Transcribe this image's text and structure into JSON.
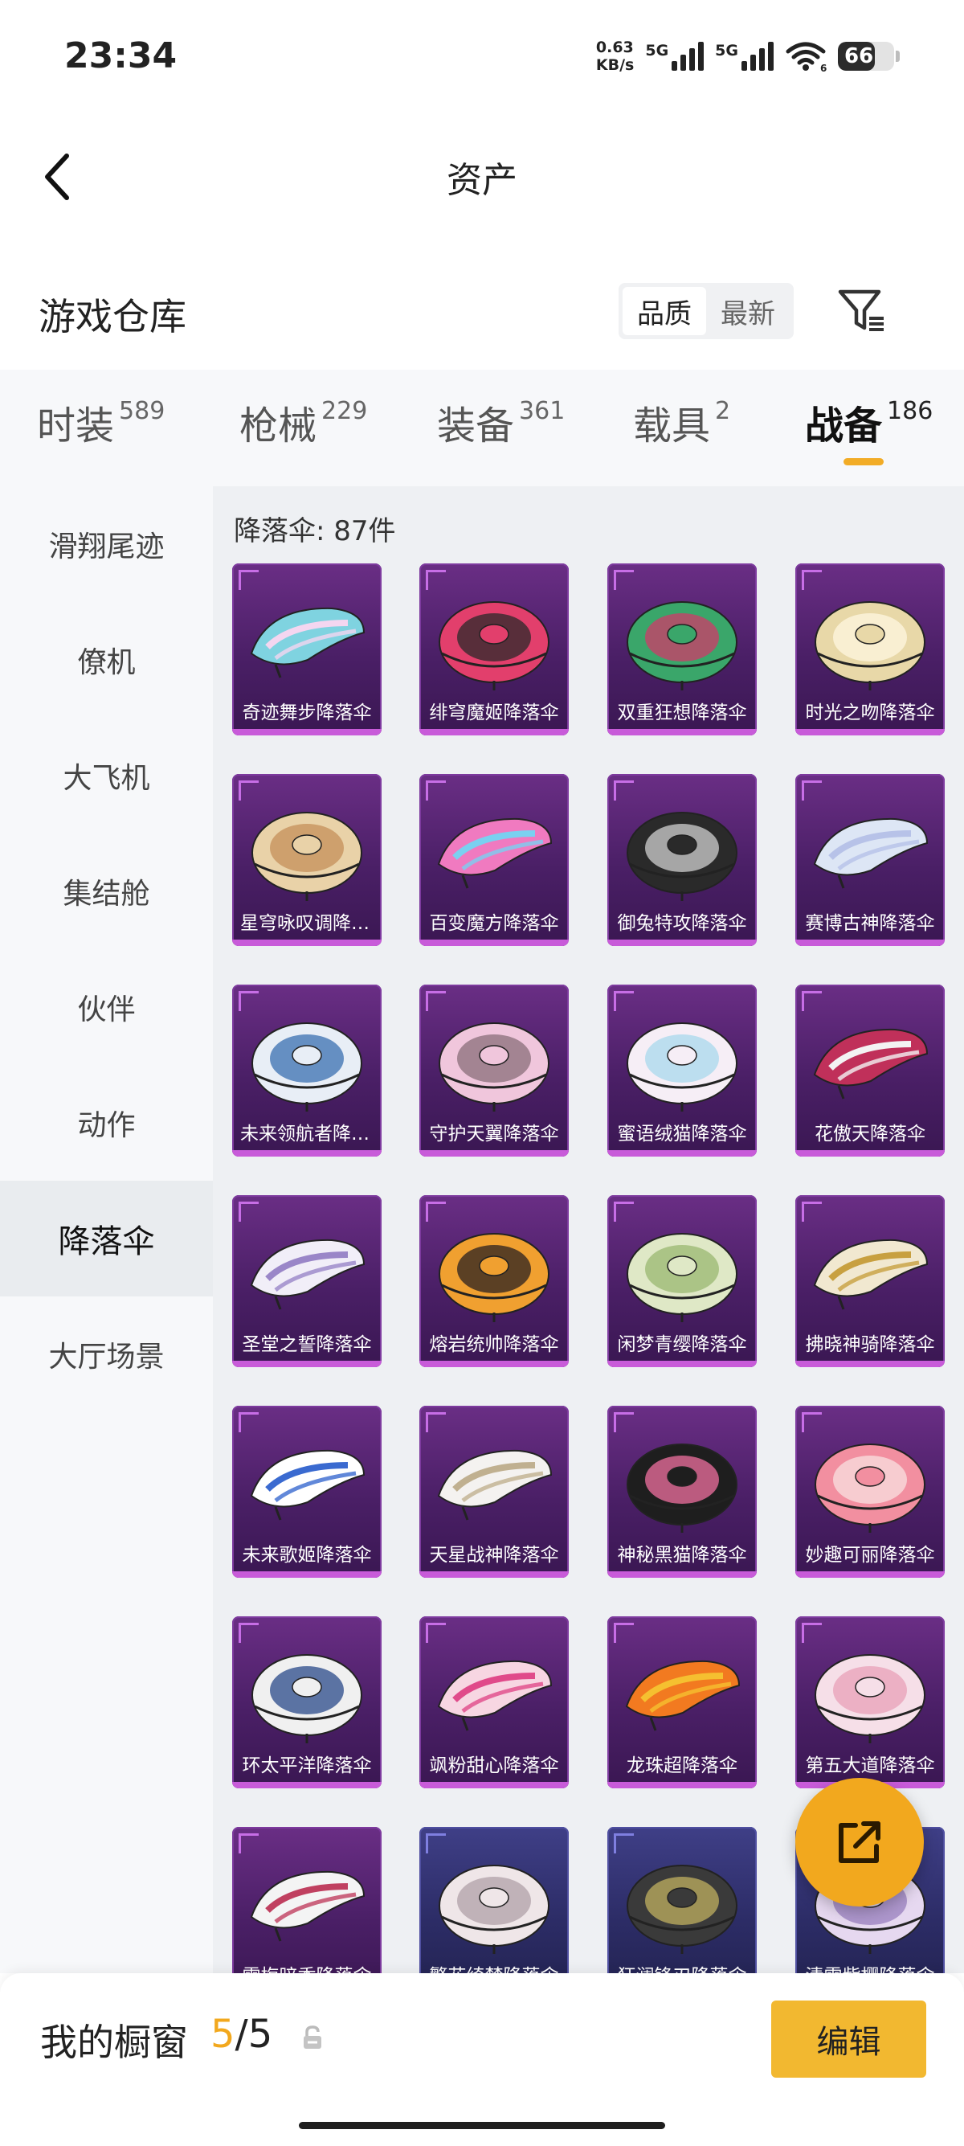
{
  "status_bar": {
    "time": "23:34",
    "net_speed_value": "0.63",
    "net_speed_unit": "KB/s",
    "sim1_label": "5G",
    "sim2_label": "5G",
    "wifi_badge": "6",
    "battery": "66",
    "battery_level": 0.66
  },
  "header": {
    "title": "资产"
  },
  "section": {
    "title": "游戏仓库",
    "sort_options": [
      "品质",
      "最新"
    ],
    "sort_active": "品质"
  },
  "category_tabs": [
    {
      "label": "时装",
      "count": "589"
    },
    {
      "label": "枪械",
      "count": "229"
    },
    {
      "label": "装备",
      "count": "361"
    },
    {
      "label": "载具",
      "count": "2"
    },
    {
      "label": "战备",
      "count": "186"
    }
  ],
  "active_tab": "战备",
  "sidebar": {
    "items": [
      "滑翔尾迹",
      "僚机",
      "大飞机",
      "集结舱",
      "伙伴",
      "动作",
      "降落伞",
      "大厅场景"
    ],
    "active": "降落伞"
  },
  "grid": {
    "header": "降落伞: 87件",
    "items": [
      {
        "name": "奇迹舞步降落伞",
        "c1": "#7fd3e0",
        "c2": "#f4d6f0",
        "tier": "purple",
        "shape": "canopy"
      },
      {
        "name": "绯穹魔姬降落伞",
        "c1": "#e23f6c",
        "c2": "#2a2a2a",
        "tier": "purple",
        "shape": "dome"
      },
      {
        "name": "双重狂想降落伞",
        "c1": "#3aa66a",
        "c2": "#d03a6a",
        "tier": "purple",
        "shape": "dome"
      },
      {
        "name": "时光之吻降落伞",
        "c1": "#e8d8a8",
        "c2": "#fff7e0",
        "tier": "purple",
        "shape": "dome"
      },
      {
        "name": "星穹咏叹调降落伞",
        "c1": "#e9d2a8",
        "c2": "#c48f5a",
        "tier": "purple",
        "shape": "dome"
      },
      {
        "name": "百变魔方降落伞",
        "c1": "#f07ac0",
        "c2": "#7ad0f0",
        "tier": "purple",
        "shape": "canopy"
      },
      {
        "name": "御兔特攻降落伞",
        "c1": "#2a2a2a",
        "c2": "#d0d0d0",
        "tier": "purple",
        "shape": "dome"
      },
      {
        "name": "赛博古神降落伞",
        "c1": "#dde6f5",
        "c2": "#b7c2e8",
        "tier": "purple",
        "shape": "canopy"
      },
      {
        "name": "未来领航者降落伞",
        "c1": "#e8eef6",
        "c2": "#3a6fb0",
        "tier": "purple",
        "shape": "dome"
      },
      {
        "name": "守护天翼降落伞",
        "c1": "#f0c6dc",
        "c2": "#8a6e7a",
        "tier": "purple",
        "shape": "dome"
      },
      {
        "name": "蜜语绒猫降落伞",
        "c1": "#f6eef6",
        "c2": "#a8d8ec",
        "tier": "purple",
        "shape": "dome"
      },
      {
        "name": "花傲天降落伞",
        "c1": "#c0305a",
        "c2": "#f3f3f3",
        "tier": "purple",
        "shape": "canopy"
      },
      {
        "name": "圣堂之誓降落伞",
        "c1": "#f1eef8",
        "c2": "#9a86c8",
        "tier": "purple",
        "shape": "canopy"
      },
      {
        "name": "熔岩统帅降落伞",
        "c1": "#f0a030",
        "c2": "#2a2020",
        "tier": "purple",
        "shape": "dome"
      },
      {
        "name": "闲梦青缨降落伞",
        "c1": "#dfe8c6",
        "c2": "#9ab870",
        "tier": "purple",
        "shape": "dome"
      },
      {
        "name": "拂晓神骑降落伞",
        "c1": "#f1e8d0",
        "c2": "#c8a040",
        "tier": "purple",
        "shape": "canopy"
      },
      {
        "name": "未来歌姬降落伞",
        "c1": "#ffffff",
        "c2": "#3a6ad0",
        "tier": "purple",
        "shape": "canopy"
      },
      {
        "name": "天星战神降落伞",
        "c1": "#f4f2f0",
        "c2": "#c0b090",
        "tier": "purple",
        "shape": "canopy"
      },
      {
        "name": "神秘黑猫降落伞",
        "c1": "#1e1e1e",
        "c2": "#f070a0",
        "tier": "purple",
        "shape": "dome"
      },
      {
        "name": "妙趣可丽降落伞",
        "c1": "#f28fa0",
        "c2": "#f8e0e0",
        "tier": "purple",
        "shape": "dome"
      },
      {
        "name": "环太平洋降落伞",
        "c1": "#f0f0f0",
        "c2": "#2a4a8a",
        "tier": "purple",
        "shape": "dome"
      },
      {
        "name": "飒粉甜心降落伞",
        "c1": "#f7d6e2",
        "c2": "#e04a8a",
        "tier": "purple",
        "shape": "canopy"
      },
      {
        "name": "龙珠超降落伞",
        "c1": "#f27a20",
        "c2": "#f5c030",
        "tier": "purple",
        "shape": "canopy"
      },
      {
        "name": "第五大道降落伞",
        "c1": "#f6dfe8",
        "c2": "#e8a0b8",
        "tier": "purple",
        "shape": "dome"
      },
      {
        "name": "雪梅暗香降落伞",
        "c1": "#f4f4f4",
        "c2": "#c04060",
        "tier": "purple",
        "shape": "canopy"
      },
      {
        "name": "繁花绮梦降落伞",
        "c1": "#efe6e8",
        "c2": "#b0a0a8",
        "tier": "blue",
        "shape": "dome"
      },
      {
        "name": "狂澜锋刃降落伞",
        "c1": "#3a3a3a",
        "c2": "#c0b060",
        "tier": "blue",
        "shape": "dome"
      },
      {
        "name": "清雪紫樱降落伞",
        "c1": "#e6d8f0",
        "c2": "#9a80c0",
        "tier": "blue",
        "shape": "dome"
      }
    ]
  },
  "bottom_bar": {
    "label": "我的橱窗",
    "current": "5",
    "total": "/5",
    "edit_label": "编辑"
  },
  "colors": {
    "accent": "#f2a81e",
    "card_purple": "#5a2677",
    "card_blue": "#33336e",
    "sidebar_bg": "#f7f8fa",
    "grid_bg": "#eef0f3"
  },
  "icons": {
    "back": "chevron-left-icon",
    "filter": "filter-funnel-icon",
    "share": "external-link-icon",
    "lock": "lock-icon"
  }
}
